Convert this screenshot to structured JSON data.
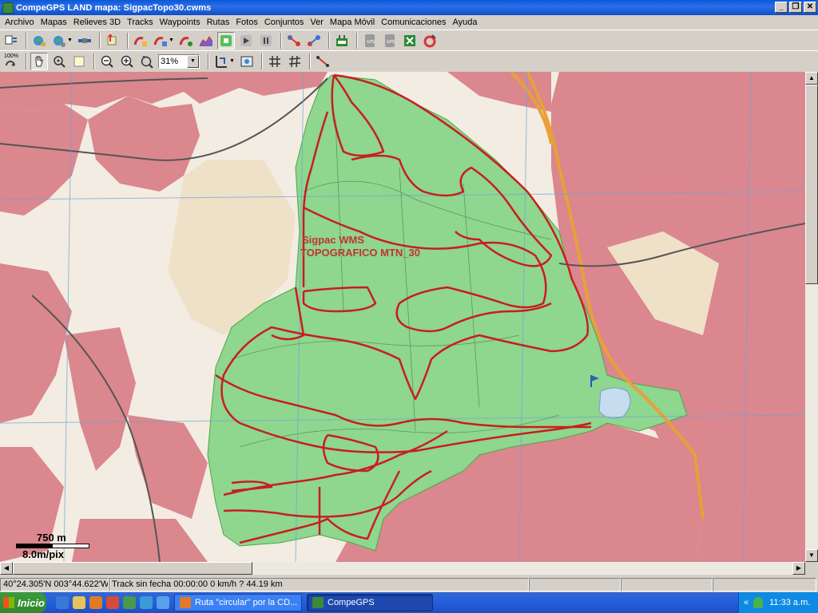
{
  "window": {
    "title": "CompeGPS LAND mapa: SigpacTopo30.cwms",
    "controls": {
      "minimize": "_",
      "restore": "❐",
      "close": "✕"
    }
  },
  "menu": [
    "Archivo",
    "Mapas",
    "Relieves 3D",
    "Tracks",
    "Waypoints",
    "Rutas",
    "Fotos",
    "Conjuntos",
    "Ver",
    "Mapa Móvil",
    "Comunicaciones",
    "Ayuda"
  ],
  "toolbar": {
    "zoom_value": "31%",
    "zoom_100_label": "100%"
  },
  "map": {
    "wms_label_1": "Sigpac WMS",
    "wms_label_2": "TOPOGRAFICO MTN_30",
    "scale_distance": "750 m",
    "scale_resolution": "8.0m/pix",
    "colors": {
      "urban": "#d9828a",
      "park": "#8fd68f",
      "track": "#c81e1e",
      "road": "#e8a038",
      "background": "#f3ece2"
    }
  },
  "status": {
    "coordinates": "40°24.305'N 003°44.622'W",
    "track_info": "Track sin fecha  00:00:00  0 km/h  ?  44.19 km"
  },
  "taskbar": {
    "start_label": "Inicio",
    "tasks": [
      "Ruta \"circular\" por la CD...",
      "CompeGPS"
    ],
    "tray_chevron": "«",
    "clock": "11:33 a.m."
  }
}
